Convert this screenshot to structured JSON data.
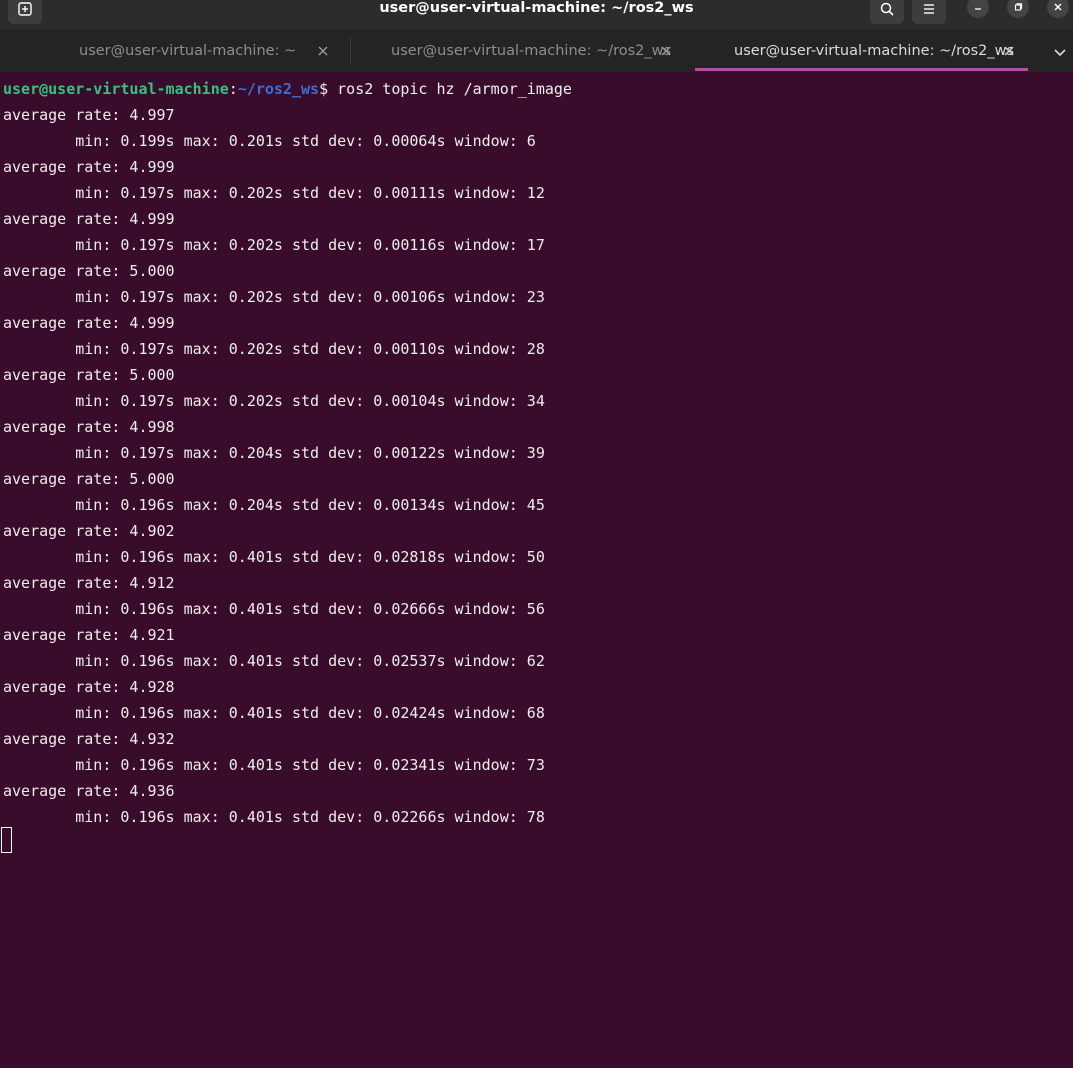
{
  "window": {
    "title": "user@user-virtual-machine: ~/ros2_ws",
    "icons": [
      "new-tab-icon",
      "search-icon",
      "menu-icon",
      "minimize-icon",
      "maximize-icon",
      "close-icon"
    ]
  },
  "tabs": [
    {
      "label": "user@user-virtual-machine: ~",
      "active": false
    },
    {
      "label": "user@user-virtual-machine: ~/ros2_ws",
      "active": false
    },
    {
      "label": "user@user-virtual-machine: ~/ros2_ws",
      "active": true
    }
  ],
  "terminal": {
    "prompt": {
      "user_host": "user@user-virtual-machine",
      "colon": ":",
      "path": "~/ros2_ws",
      "dollar": "$",
      "command": " ros2 topic hz /armor_image"
    },
    "output": [
      "average rate: 4.997",
      "        min: 0.199s max: 0.201s std dev: 0.00064s window: 6",
      "average rate: 4.999",
      "        min: 0.197s max: 0.202s std dev: 0.00111s window: 12",
      "average rate: 4.999",
      "        min: 0.197s max: 0.202s std dev: 0.00116s window: 17",
      "average rate: 5.000",
      "        min: 0.197s max: 0.202s std dev: 0.00106s window: 23",
      "average rate: 4.999",
      "        min: 0.197s max: 0.202s std dev: 0.00110s window: 28",
      "average rate: 5.000",
      "        min: 0.197s max: 0.202s std dev: 0.00104s window: 34",
      "average rate: 4.998",
      "        min: 0.197s max: 0.204s std dev: 0.00122s window: 39",
      "average rate: 5.000",
      "        min: 0.196s max: 0.204s std dev: 0.00134s window: 45",
      "average rate: 4.902",
      "        min: 0.196s max: 0.401s std dev: 0.02818s window: 50",
      "average rate: 4.912",
      "        min: 0.196s max: 0.401s std dev: 0.02666s window: 56",
      "average rate: 4.921",
      "        min: 0.196s max: 0.401s std dev: 0.02537s window: 62",
      "average rate: 4.928",
      "        min: 0.196s max: 0.401s std dev: 0.02424s window: 68",
      "average rate: 4.932",
      "        min: 0.196s max: 0.401s std dev: 0.02341s window: 73",
      "average rate: 4.936",
      "        min: 0.196s max: 0.401s std dev: 0.02266s window: 78"
    ]
  },
  "colors": {
    "background": "#380c2a",
    "prompt_user": "#33c47f",
    "prompt_path": "#3b6fd6",
    "active_tab_indicator": "#b54fa0"
  }
}
